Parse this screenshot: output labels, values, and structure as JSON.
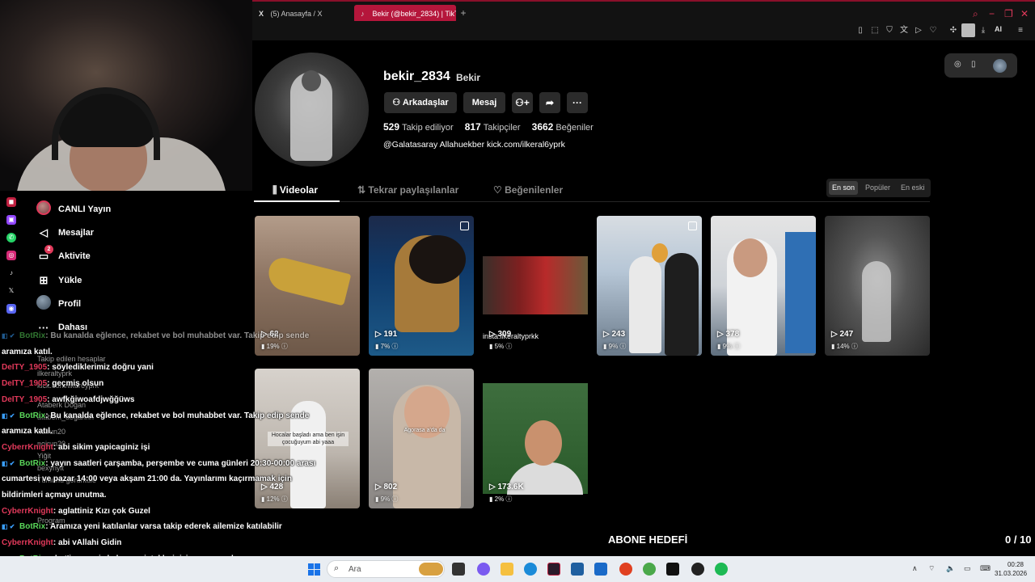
{
  "browser": {
    "tabs": [
      {
        "icon": "X",
        "label": "(5) Anasayfa / X"
      },
      {
        "icon": "♪",
        "label": "Bekir (@bekir_2834) | TikT"
      }
    ],
    "new_tab": "+",
    "ai_label": "AI"
  },
  "sidebar": {
    "items": [
      {
        "label": "CANLI Yayın",
        "icon": "live-avatar"
      },
      {
        "label": "Mesajlar",
        "icon": "send-icon"
      },
      {
        "label": "Aktivite",
        "icon": "activity-icon",
        "badge": "2"
      },
      {
        "label": "Yükle",
        "icon": "upload-icon"
      },
      {
        "label": "Profil",
        "icon": "profile-avatar"
      },
      {
        "label": "Dahası",
        "icon": "more-icon"
      }
    ],
    "following_header": "Takip edilen hesaplar",
    "following": [
      "ilkeraltyprk",
      "kick.com/ilker6yprk",
      "Ataberk Doğan",
      "ataberk_dogannn",
      "noirun20",
      "noirun20",
      "Yiğit",
      "bexynyit",
      "Tümünü görüntüle",
      "Program"
    ]
  },
  "profile": {
    "username": "bekir_2834",
    "nickname": "Bekir",
    "friends_button": "Arkadaşlar",
    "message_button": "Mesaj",
    "following_count": "529",
    "following_label": "Takip ediliyor",
    "followers_count": "817",
    "followers_label": "Takipçiler",
    "likes_count": "3662",
    "likes_label": "Beğeniler",
    "bio": "@Galatasaray Allahuekber kick.com/ilkeral6yprk"
  },
  "tabs": {
    "videos": "Videolar",
    "reposts": "Tekrar paylaşılanlar",
    "liked": "Beğenilenler"
  },
  "sort": {
    "latest": "En son",
    "popular": "Popüler",
    "oldest": "En eski"
  },
  "videos": [
    {
      "views": "62",
      "pct": "19%"
    },
    {
      "views": "191",
      "pct": "7%"
    },
    {
      "views": "309",
      "pct": "5%",
      "caption": "insta:ilkeraltyprkk"
    },
    {
      "views": "243",
      "pct": "9%"
    },
    {
      "views": "378",
      "pct": "9%"
    },
    {
      "views": "247",
      "pct": "14%"
    },
    {
      "views": "428",
      "pct": "12%",
      "caption": "Hocalar başladı ama ben işin çocuğuyum abi yaaa"
    },
    {
      "views": "802",
      "pct": "9%",
      "caption": "Agorasa a'da da"
    },
    {
      "views": "173.6K",
      "pct": "2%"
    }
  ],
  "chat": [
    {
      "name": "BotRix",
      "text": ": Bu kanalda eğlence, rekabet ve bol muhabbet var. Takip edip sende",
      "cls": "nm-grn",
      "faded": true
    },
    {
      "name": "",
      "text": "aramıza katıl.",
      "cls": "",
      "faded": false
    },
    {
      "name": "DeITY_1905",
      "text": ": söylediklerimiz doğru yani",
      "cls": "nm-red",
      "faded": false
    },
    {
      "name": "DeITY_1905",
      "text": ": geçmiş olsun",
      "cls": "nm-red",
      "faded": false
    },
    {
      "name": "DeITY_1905",
      "text": ": awfkğiwoafdjwğğüws",
      "cls": "nm-red",
      "faded": false
    },
    {
      "name": "BotRix",
      "text": ": Bu kanalda eğlence, rekabet ve bol muhabbet var. Takip edip sende",
      "cls": "nm-grn",
      "faded": false
    },
    {
      "name": "",
      "text": "aramıza katıl.",
      "cls": "",
      "faded": false
    },
    {
      "name": "CyberrKnight",
      "text": ": abi sikim yapicaginiz işi",
      "cls": "nm-red",
      "faded": false
    },
    {
      "name": "BotRix",
      "text": ": yayın saatleri çarşamba, perşembe ve cuma günleri 20:30-00:00 arası",
      "cls": "nm-grn",
      "faded": false
    },
    {
      "name": "",
      "text": "cumartesi ve pazar 14:00 veya akşam 21:00 da. Yayınlarımı kaçırmamak için",
      "cls": "",
      "faded": false
    },
    {
      "name": "",
      "text": "bildirimleri açmayı unutma.",
      "cls": "",
      "faded": false
    },
    {
      "name": "CyberrKnight",
      "text": ": aglattiniz Kızı çok Guzel",
      "cls": "nm-red",
      "faded": false
    },
    {
      "name": "BotRix",
      "text": ": Aramıza yeni katılanlar varsa takip ederek ailemize katılabilir",
      "cls": "nm-grn",
      "faded": false
    },
    {
      "name": "CyberrKnight",
      "text": ": abi vAllahi Gidin",
      "cls": "nm-red",
      "faded": false
    },
    {
      "name": "BotRix",
      "text": ": chat'im sessiz kalmayın isteklerinizi yazın yapalım",
      "cls": "nm-grn",
      "faded": false
    },
    {
      "name": "BotRix",
      "text": ": Bu kanalda eğlence, rekabet ve bol muhabbet var. Takip edip sende",
      "cls": "nm-grn",
      "faded": true
    },
    {
      "name": "",
      "text": "aramıza katıl.",
      "cls": "",
      "faded": true
    }
  ],
  "goal": {
    "label": "ABONE HEDEFİ",
    "count": "0 / 10"
  },
  "taskbar": {
    "search_placeholder": "Ara",
    "time": "00:28",
    "date": "31.03.2026"
  },
  "colors": {
    "accent": "#e0395a",
    "active_tab": "#b5163b",
    "bot_green": "#5ad65a"
  }
}
